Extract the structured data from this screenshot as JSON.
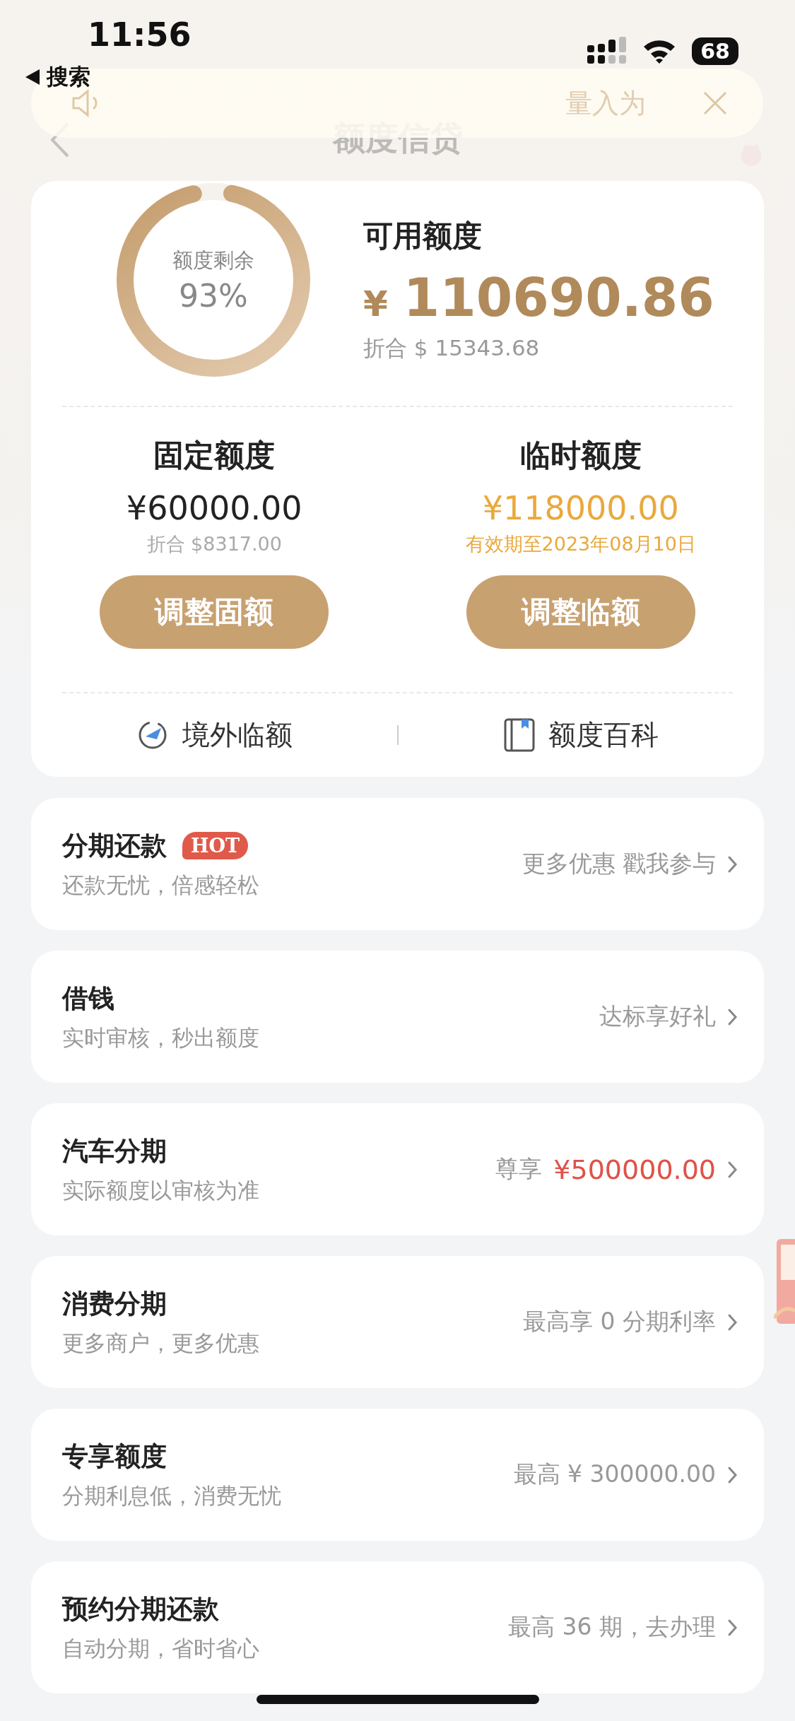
{
  "status_bar": {
    "time": "11:56",
    "back_label": "搜索",
    "battery": "68"
  },
  "notice": {
    "text": "量入为"
  },
  "header": {
    "title": "额度信贷"
  },
  "quota": {
    "ring_label": "额度剩余",
    "ring_percent": "93%",
    "level": 0.93,
    "available_label": "可用额度",
    "currency": "¥",
    "amount": "110690.86",
    "converted": "折合 $ 15343.68"
  },
  "limits": [
    {
      "kind": "fixed",
      "title": "固定额度",
      "amount": "¥60000.00",
      "note": "折合 $8317.00",
      "button": "调整固额"
    },
    {
      "kind": "temporary",
      "title": "临时额度",
      "amount": "¥118000.00",
      "note": "有效期至2023年08月10日",
      "button": "调整临额"
    }
  ],
  "links": [
    {
      "kind": "plane",
      "label": "境外临额"
    },
    {
      "kind": "book",
      "label": "额度百科"
    }
  ],
  "services": [
    {
      "title": "分期还款",
      "badge": "HOT",
      "subtitle": "还款无忧，倍感轻松",
      "right": [
        {
          "kind": "muted",
          "text": "更多优惠 戳我参与"
        }
      ]
    },
    {
      "title": "借钱",
      "subtitle": "实时审核，秒出额度",
      "right": [
        {
          "kind": "muted",
          "text": "达标享好礼"
        }
      ]
    },
    {
      "title": "汽车分期",
      "subtitle": "实际额度以审核为准",
      "right": [
        {
          "kind": "muted",
          "text": "尊享"
        },
        {
          "kind": "highlight",
          "text": "¥500000.00"
        }
      ]
    },
    {
      "title": "消费分期",
      "subtitle": "更多商户，更多优惠",
      "right": [
        {
          "kind": "muted",
          "text": "最高享 0 分期利率"
        }
      ]
    },
    {
      "title": "专享额度",
      "subtitle": "分期利息低，消费无忧",
      "right": [
        {
          "kind": "muted",
          "text": "最高 ¥ 300000.00"
        }
      ]
    },
    {
      "title": "预约分期还款",
      "subtitle": "自动分期，省时省心",
      "right": [
        {
          "kind": "muted",
          "text": "最高 36 期，去办理"
        }
      ]
    }
  ]
}
